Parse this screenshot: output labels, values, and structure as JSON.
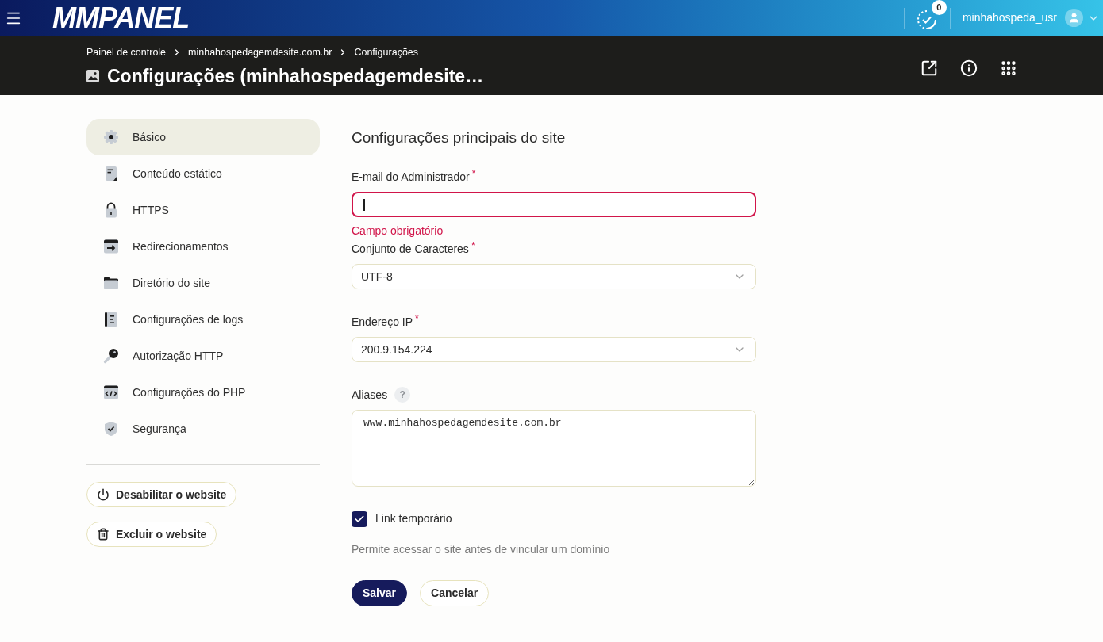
{
  "topbar": {
    "logo": "MMPANEL",
    "task_count": "0",
    "username": "minhahospeda_usr"
  },
  "page_header": {
    "breadcrumb": [
      "Painel de controle",
      "minhahospedagemdesite.com.br",
      "Configurações"
    ],
    "title": "Configurações (minhahospedagemdesite…"
  },
  "sidebar": {
    "items": [
      {
        "label": "Básico",
        "selected": true
      },
      {
        "label": "Conteúdo estático",
        "selected": false
      },
      {
        "label": "HTTPS",
        "selected": false
      },
      {
        "label": "Redirecionamentos",
        "selected": false
      },
      {
        "label": "Diretório do site",
        "selected": false
      },
      {
        "label": "Configurações de logs",
        "selected": false
      },
      {
        "label": "Autorização HTTP",
        "selected": false
      },
      {
        "label": "Configurações do PHP",
        "selected": false
      },
      {
        "label": "Segurança",
        "selected": false
      }
    ],
    "actions": [
      "Desabilitar o website",
      "Excluir o website"
    ]
  },
  "form": {
    "heading": "Configurações principais do site",
    "fields": [
      {
        "kind": "input",
        "label": "E-mail do Administrador",
        "required_mark": "*",
        "invalid": true,
        "focused": true,
        "error": "Campo obrigatório"
      },
      {
        "kind": "select",
        "label": "Conjunto de Caracteres",
        "required_mark": "*",
        "invalid": false,
        "value": "UTF-8"
      },
      {
        "kind": "select",
        "label": "Endereço IP",
        "required_mark": "*",
        "invalid": false,
        "value": "200.9.154.224"
      },
      {
        "kind": "textarea",
        "label": "Aliases",
        "help_mark": "?",
        "invalid": false,
        "value": "www.minhahospedagemdesite.com.br"
      }
    ],
    "option": {
      "label": "Link temporário",
      "checked": true,
      "hint": "Permite acessar o site antes de vincular um domínio"
    },
    "buttons": [
      {
        "kind": "primary",
        "label": "Salvar"
      },
      {
        "kind": "secondary",
        "label": "Cancelar"
      }
    ]
  }
}
